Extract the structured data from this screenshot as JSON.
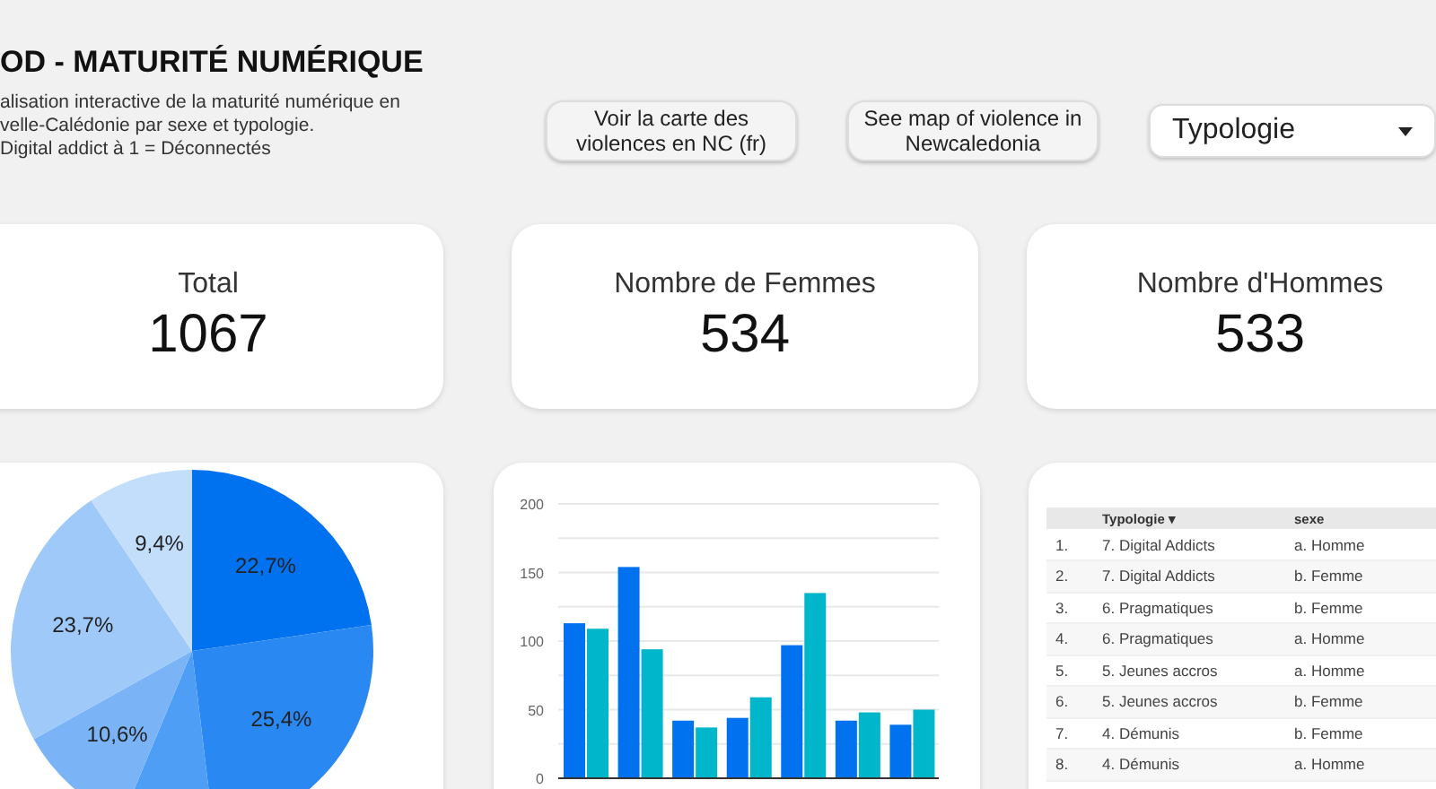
{
  "header": {
    "title": "OD - MATURITÉ NUMÉRIQUE",
    "description_lines": [
      "alisation interactive de la maturité numérique en",
      "velle-Calédonie par sexe et typologie.",
      "Digital addict à 1 = Déconnectés"
    ]
  },
  "buttons": [
    {
      "label": "Voir la carte des violences en NC (fr)"
    },
    {
      "label": "See map of violence in Newcaledonia"
    }
  ],
  "dropdown": {
    "value": "Typologie"
  },
  "kpis": [
    {
      "label": "Total",
      "value": "1067"
    },
    {
      "label": "Nombre de Femmes",
      "value": "534"
    },
    {
      "label": "Nombre d'Hommes",
      "value": "533"
    }
  ],
  "pie": {
    "chart_data": {
      "type": "pie",
      "values": [
        22.7,
        25.4,
        8.2,
        10.6,
        23.7,
        9.4
      ],
      "value_labels": [
        "22,7%",
        "25,4%",
        null,
        "10,6%",
        "23,7%",
        "9,4%"
      ],
      "colors": [
        "#0072f0",
        "#2a88f2",
        "#4f9ef5",
        "#7ab4f7",
        "#9fc9f9",
        "#c3defb"
      ]
    }
  },
  "bars": {
    "chart_data": {
      "type": "bar",
      "grid": true,
      "ylim": [
        0,
        200
      ],
      "yticks": [
        0,
        50,
        100,
        150,
        200
      ],
      "series": [
        {
          "color": "#0072f0",
          "values": [
            113,
            154,
            42,
            44,
            97,
            42,
            39
          ]
        },
        {
          "color": "#00b6cb",
          "values": [
            109,
            94,
            37,
            59,
            135,
            48,
            50
          ]
        }
      ]
    }
  },
  "table": {
    "columns": [
      "Typologie ▾",
      "sexe"
    ],
    "rows": [
      {
        "index": "1.",
        "cells": [
          "7. Digital Addicts",
          "a. Homme"
        ]
      },
      {
        "index": "2.",
        "cells": [
          "7. Digital Addicts",
          "b. Femme"
        ]
      },
      {
        "index": "3.",
        "cells": [
          "6. Pragmatiques",
          "b. Femme"
        ]
      },
      {
        "index": "4.",
        "cells": [
          "6. Pragmatiques",
          "a. Homme"
        ]
      },
      {
        "index": "5.",
        "cells": [
          "5. Jeunes accros",
          "a. Homme"
        ]
      },
      {
        "index": "6.",
        "cells": [
          "5. Jeunes accros",
          "b. Femme"
        ]
      },
      {
        "index": "7.",
        "cells": [
          "4. Démunis",
          "b. Femme"
        ]
      },
      {
        "index": "8.",
        "cells": [
          "4. Démunis",
          "a. Homme"
        ]
      }
    ]
  }
}
